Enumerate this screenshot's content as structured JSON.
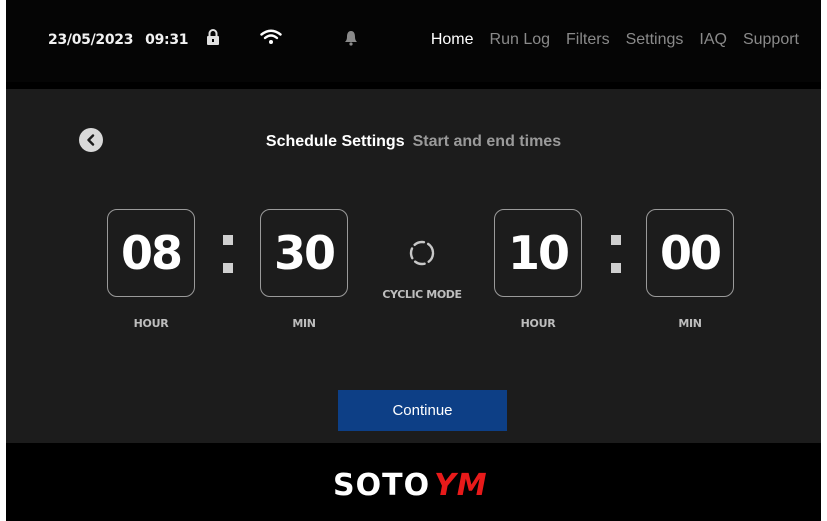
{
  "status_bar": {
    "date": "23/05/2023",
    "time": "09:31",
    "icons": [
      "lock-icon",
      "wifi-icon",
      "bell-icon"
    ]
  },
  "nav": {
    "items": [
      {
        "label": "Home",
        "active": true
      },
      {
        "label": "Run Log",
        "active": false
      },
      {
        "label": "Filters",
        "active": false
      },
      {
        "label": "Settings",
        "active": false
      },
      {
        "label": "IAQ",
        "active": false
      },
      {
        "label": "Support",
        "active": false
      }
    ]
  },
  "schedule": {
    "title": "Schedule Settings",
    "subtitle": "Start and end times",
    "start": {
      "hour": "08",
      "minute": "30"
    },
    "end": {
      "hour": "10",
      "minute": "00"
    },
    "hour_label": "HOUR",
    "min_label": "MIN",
    "mode_label": "CYCLIC MODE",
    "continue_label": "Continue"
  },
  "brand": {
    "logo_main": "SOTO",
    "logo_accent": "YM"
  },
  "colors": {
    "background": "#000000",
    "panel": "#1c1c1c",
    "button": "#0d3f86",
    "brand_red": "#e81a1a"
  }
}
